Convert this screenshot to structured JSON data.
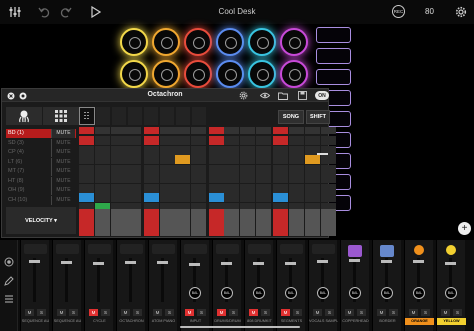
{
  "top_bar": {
    "title": "Cool Desk",
    "rec_label": "REC",
    "tempo": "80"
  },
  "pad_colors": [
    "#f2d84a",
    "#f0a830",
    "#e84c3c",
    "#5b8cf0",
    "#39c4e0",
    "#c84ad8"
  ],
  "scene_color": "#a98ee0",
  "octachron": {
    "title": "Octachron",
    "on_label": "ON",
    "song_label": "SONG",
    "shift_label": "SHIFT",
    "velocity_label": "VELOCITY ▾",
    "mute_label": "MUTE",
    "selected_row": 0,
    "rows": [
      "BD (1)",
      "SD (3)",
      "CP (4)",
      "LT (6)",
      "MT (7)",
      "HT (8)",
      "OH (9)",
      "CH (10)"
    ],
    "colors": {
      "red": "#c62828",
      "orange": "#e09a20",
      "blue": "#2a8fd6",
      "green": "#2ea84a"
    },
    "steps": [
      [
        1,
        0,
        0,
        0,
        1,
        0,
        0,
        0,
        1,
        0,
        0,
        0,
        1,
        0,
        0,
        0
      ],
      [
        0,
        0,
        0,
        0,
        0,
        0,
        0,
        0,
        0,
        0,
        0,
        0,
        0,
        0,
        0,
        0
      ],
      [
        0,
        0,
        0,
        0,
        0,
        0,
        1,
        0,
        0,
        0,
        0,
        0,
        0,
        0,
        1,
        0
      ],
      [
        0,
        0,
        0,
        0,
        0,
        0,
        0,
        0,
        0,
        0,
        0,
        0,
        0,
        0,
        0,
        0
      ],
      [
        0,
        0,
        0,
        0,
        0,
        0,
        0,
        0,
        0,
        0,
        0,
        0,
        0,
        0,
        0,
        0
      ],
      [
        0,
        0,
        0,
        0,
        0,
        0,
        0,
        0,
        0,
        0,
        0,
        0,
        0,
        0,
        0,
        0
      ],
      [
        1,
        0,
        0,
        0,
        1,
        0,
        0,
        0,
        1,
        0,
        0,
        0,
        1,
        0,
        0,
        0
      ],
      [
        0,
        1,
        0,
        0,
        0,
        0,
        0,
        0,
        0,
        0,
        0,
        0,
        0,
        0,
        0,
        0
      ]
    ],
    "step_colors": [
      "red",
      "",
      "orange",
      "",
      "",
      "",
      "blue",
      "green"
    ],
    "velocities": [
      1,
      0,
      0,
      0,
      1,
      0,
      0,
      0,
      1,
      0,
      0,
      0,
      1,
      0,
      0,
      0
    ]
  },
  "mixer": {
    "m_label": "M",
    "s_label": "S",
    "bal_label": "BAL",
    "channels": [
      {
        "name": "SEQUENCE AU",
        "muted": false,
        "swatch": ""
      },
      {
        "name": "SEQUENCE AU",
        "muted": false,
        "swatch": ""
      },
      {
        "name": "CYCLE",
        "muted": true,
        "swatch": ""
      },
      {
        "name": "OCTACHRON",
        "muted": false,
        "swatch": ""
      },
      {
        "name": "ATOM PIANO",
        "muted": false,
        "swatch": ""
      },
      {
        "name": "INPUT",
        "muted": true,
        "swatch": ""
      },
      {
        "name": "DRUMS/DRUM",
        "muted": true,
        "swatch": ""
      },
      {
        "name": "808 DRUMKIT",
        "muted": true,
        "swatch": ""
      },
      {
        "name": "SEGMENTS",
        "muted": true,
        "swatch": ""
      },
      {
        "name": "VOCALS SAMPL",
        "muted": false,
        "swatch": ""
      },
      {
        "name": "COPPERHEAD",
        "muted": false,
        "swatch": "#9b59d0"
      },
      {
        "name": "BORDER",
        "muted": false,
        "swatch": "#6688cc"
      },
      {
        "name": "ORANGE",
        "muted": false,
        "swatch": "#f0901c"
      },
      {
        "name": "YELLOW",
        "muted": false,
        "swatch": "#f2d030"
      }
    ]
  }
}
